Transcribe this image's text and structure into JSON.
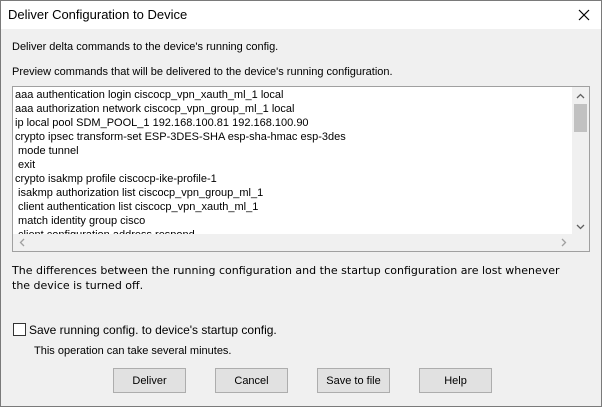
{
  "dialog": {
    "title": "Deliver Configuration to Device",
    "intro": "Deliver delta commands to the device's running config.",
    "preview_label": "Preview commands that will be delivered to the device's running configuration.",
    "preview_lines": [
      "aaa authentication login ciscocp_vpn_xauth_ml_1 local",
      "aaa authorization network ciscocp_vpn_group_ml_1 local",
      "ip local pool SDM_POOL_1 192.168.100.81 192.168.100.90",
      "crypto ipsec transform-set ESP-3DES-SHA esp-sha-hmac esp-3des",
      " mode tunnel",
      " exit",
      "crypto isakmp profile ciscocp-ike-profile-1",
      " isakmp authorization list ciscocp_vpn_group_ml_1",
      " client authentication list ciscocp_vpn_xauth_ml_1",
      " match identity group cisco",
      " client configuration address respond"
    ],
    "info_line1": "The differences between the running configuration and the startup configuration are lost whenever",
    "info_line2": "the device is turned off.",
    "save_checkbox_label": "Save running config. to device's startup config.",
    "save_checked": false,
    "operation_note": "This operation can take several minutes."
  },
  "buttons": {
    "deliver": "Deliver",
    "cancel": "Cancel",
    "save_to_file": "Save to file",
    "help": "Help"
  },
  "icons": {
    "close": "close-icon",
    "scroll_up": "chevron-up-icon",
    "scroll_down": "chevron-down-icon",
    "scroll_left": "chevron-left-icon",
    "scroll_right": "chevron-right-icon"
  },
  "colors": {
    "window_bg": "#f0f0f0",
    "titlebar_bg": "#ffffff",
    "button_bg": "#e1e1e1",
    "button_border": "#adadad"
  }
}
